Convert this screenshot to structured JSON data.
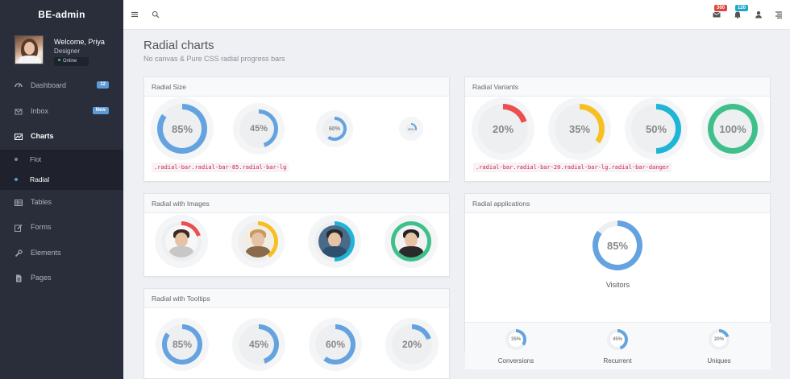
{
  "brand": "BE-admin",
  "profile": {
    "welcome": "Welcome, Priya",
    "role": "Designer",
    "status": "Online"
  },
  "nav": [
    {
      "label": "Dashboard",
      "icon": "dashboard-icon",
      "badge": "12"
    },
    {
      "label": "Inbox",
      "icon": "inbox-icon",
      "badge": "New"
    },
    {
      "label": "Charts",
      "icon": "chart-icon",
      "active": true
    },
    {
      "label": "Tables",
      "icon": "table-icon"
    },
    {
      "label": "Forms",
      "icon": "edit-icon"
    },
    {
      "label": "Elements",
      "icon": "wrench-icon"
    },
    {
      "label": "Pages",
      "icon": "file-icon"
    }
  ],
  "subnav": [
    {
      "label": "Flot"
    },
    {
      "label": "Radial",
      "active": true
    }
  ],
  "topbar": {
    "mail_badge": "300",
    "notify_badge": "120"
  },
  "page": {
    "title": "Radial charts",
    "subtitle": "No canvas & Pure CSS radial progress bars"
  },
  "cards": {
    "size": {
      "title": "Radial Size",
      "items": [
        {
          "value": 85,
          "label": "85%"
        },
        {
          "value": 45,
          "label": "45%"
        },
        {
          "value": 60,
          "label": "60%"
        },
        {
          "value": 30,
          "label": "30%"
        }
      ],
      "code": ".radial-bar.radial-bar-85.radial-bar-lg"
    },
    "variants": {
      "title": "Radial Variants",
      "items": [
        {
          "value": 20,
          "label": "20%",
          "color": "#ec4f4f"
        },
        {
          "value": 35,
          "label": "35%",
          "color": "#f6c024"
        },
        {
          "value": 50,
          "label": "50%",
          "color": "#1fb5d6"
        },
        {
          "value": 100,
          "label": "100%",
          "color": "#3fc08b"
        }
      ],
      "code": ".radial-bar.radial-bar-20.radial-bar-lg.radial-bar-danger"
    },
    "images": {
      "title": "Radial with Images",
      "items": [
        {
          "value": 20,
          "color": "#ec4f4f"
        },
        {
          "value": 40,
          "color": "#f6c024"
        },
        {
          "value": 50,
          "color": "#1fb5d6"
        },
        {
          "value": 100,
          "color": "#3fc08b"
        }
      ]
    },
    "tooltips": {
      "title": "Radial with Tooltips",
      "items": [
        {
          "value": 85,
          "label": "85%"
        },
        {
          "value": 45,
          "label": "45%"
        },
        {
          "value": 60,
          "label": "60%"
        },
        {
          "value": 20,
          "label": "20%"
        }
      ]
    },
    "applications": {
      "title": "Radial applications",
      "main": {
        "value": 85,
        "label": "85%",
        "caption": "Visitors"
      },
      "stats": [
        {
          "value": 35,
          "label": "35%",
          "caption": "Conversions"
        },
        {
          "value": 45,
          "label": "45%",
          "caption": "Recurrent"
        },
        {
          "value": 20,
          "label": "20%",
          "caption": "Uniques"
        }
      ]
    }
  },
  "colors": {
    "primary": "#64a3e0",
    "track": "#eeeff1"
  }
}
